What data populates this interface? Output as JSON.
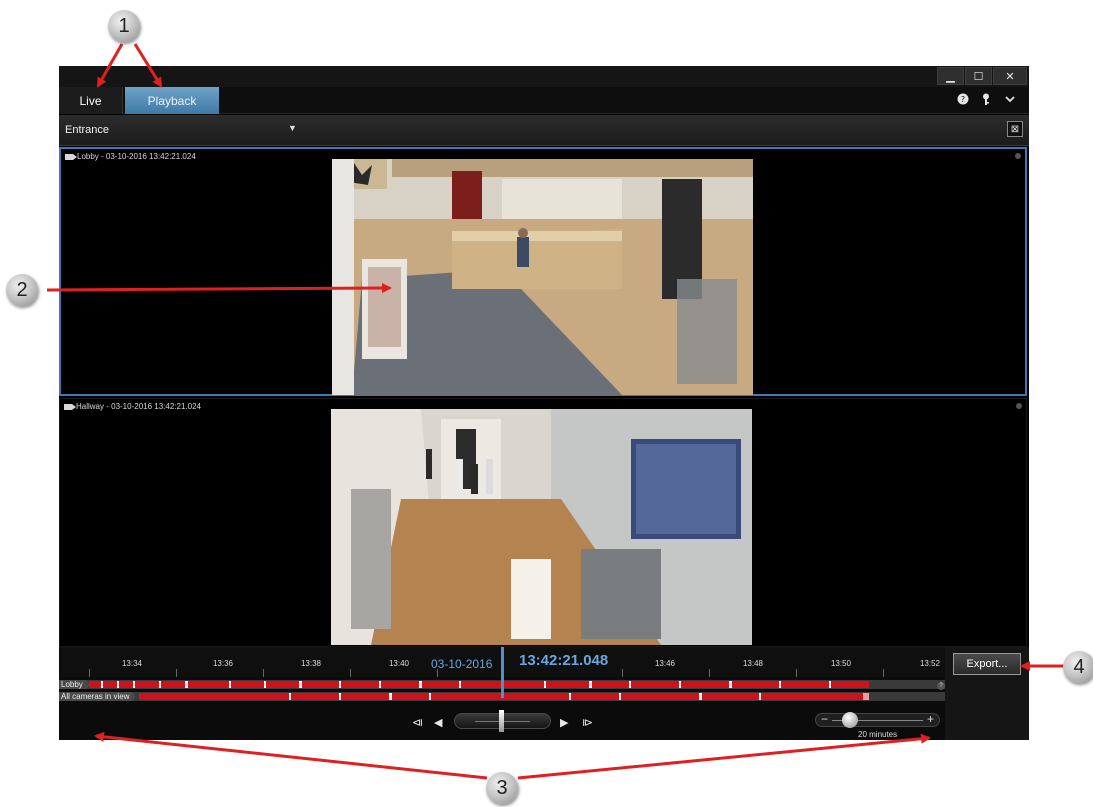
{
  "callouts": [
    "1",
    "2",
    "3",
    "4"
  ],
  "window": {
    "controls": {
      "minimize": "▁",
      "maximize": "☐",
      "close": "✕"
    },
    "tabs": [
      {
        "label": "Live",
        "active": false
      },
      {
        "label": "Playback",
        "active": true
      }
    ],
    "toolbar_icons": [
      "help-icon",
      "key-icon",
      "chevron-down-icon"
    ],
    "view": {
      "name": "Entrance",
      "caret": "▼",
      "maximize_icon": "⊠"
    }
  },
  "panes": [
    {
      "title": "Lobby - 03-10-2016 13:42:21.024",
      "selected": true
    },
    {
      "title": "Hallway - 03-10-2016 13:42:21.024",
      "selected": false
    }
  ],
  "timeline": {
    "ticks": [
      "13:34",
      "13:36",
      "13:38",
      "13:40",
      "13:46",
      "13:48",
      "13:50",
      "13:52"
    ],
    "date": "03-10-2016",
    "time": "13:42:21.048",
    "tracks": [
      {
        "label": "Lobby",
        "color": "#d0101a"
      },
      {
        "label": "All cameras in view",
        "color": "#d0101a"
      }
    ],
    "help": "?",
    "transport": {
      "prev_frame": "⧏",
      "play_reverse": "◀",
      "play_forward": "▶",
      "next_frame": "⧐"
    },
    "zoom": {
      "minus": "−",
      "plus": "+",
      "span": "20 minutes"
    },
    "export_label": "Export..."
  },
  "colors": {
    "accent": "#3d7ab5",
    "recording": "#d0101a",
    "callout_arrow": "#e02020"
  }
}
